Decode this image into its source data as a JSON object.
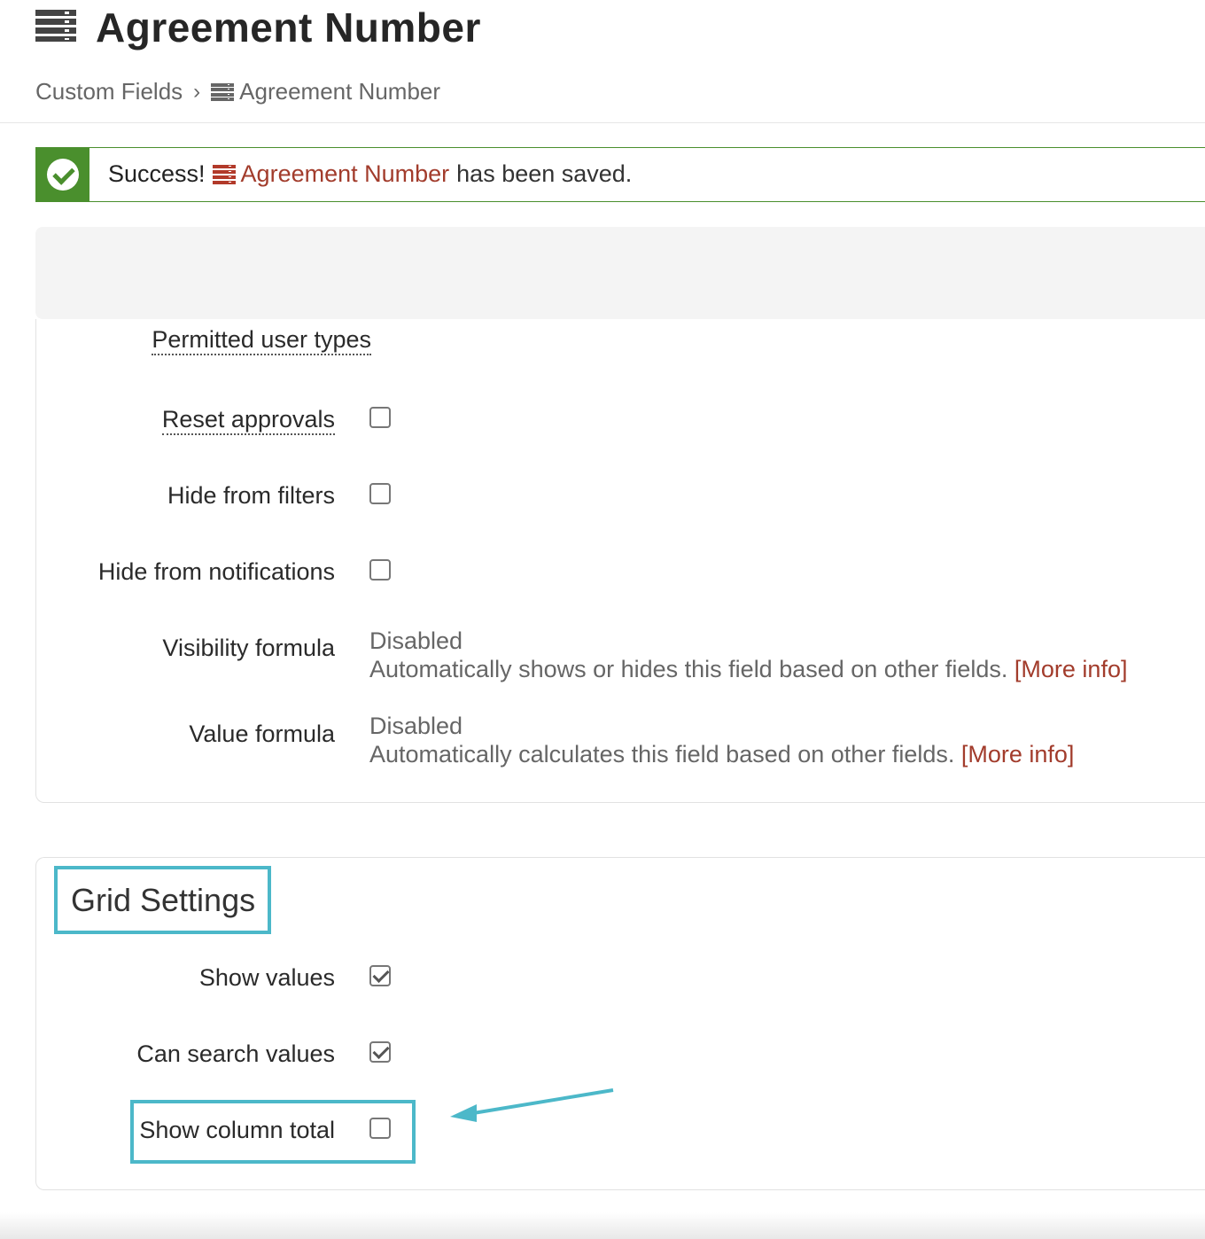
{
  "header": {
    "title": "Agreement Number",
    "breadcrumb": {
      "parent": "Custom Fields",
      "separator": "›",
      "current": "Agreement Number"
    }
  },
  "alert": {
    "strong": "Success!",
    "link": "Agreement Number",
    "message": "has been saved."
  },
  "settings": {
    "permitted_label": "Permitted user types",
    "reset_approvals": {
      "label": "Reset approvals",
      "checked": false
    },
    "hide_from_filters": {
      "label": "Hide from filters",
      "checked": false
    },
    "hide_from_notifications": {
      "label": "Hide from notifications",
      "checked": false
    },
    "visibility_formula": {
      "label": "Visibility formula",
      "status": "Disabled",
      "desc": "Automatically shows or hides this field based on other fields.",
      "more": "[More info]"
    },
    "value_formula": {
      "label": "Value formula",
      "status": "Disabled",
      "desc": "Automatically calculates this field based on other fields.",
      "more": "[More info]"
    }
  },
  "grid": {
    "heading": "Grid Settings",
    "show_values": {
      "label": "Show values",
      "checked": true
    },
    "can_search_values": {
      "label": "Can search values",
      "checked": true
    },
    "show_column_total": {
      "label": "Show column total",
      "checked": false
    }
  },
  "colors": {
    "accent": "#a23c2c",
    "success": "#4a8f2d",
    "highlight": "#4cb8c9"
  }
}
